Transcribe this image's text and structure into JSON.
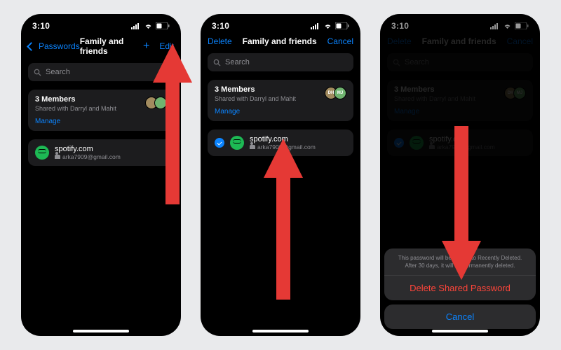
{
  "status_bar": {
    "time": "3:10"
  },
  "screen1": {
    "nav_back": "Passwords",
    "nav_title": "Family and friends",
    "nav_edit": "Edit",
    "search_placeholder": "Search",
    "members_title": "3 Members",
    "members_sub": "Shared with Darryl and Mahit",
    "manage": "Manage",
    "avatars": [
      "DH",
      "MJ"
    ],
    "cred_site": "spotify.com",
    "cred_user": "arka7909@gmail.com"
  },
  "screen2": {
    "nav_delete": "Delete",
    "nav_title": "Family and friends",
    "nav_cancel": "Cancel",
    "search_placeholder": "Search",
    "members_title": "3 Members",
    "members_sub": "Shared with Darryl and Mahit",
    "manage": "Manage",
    "avatars": [
      "DH",
      "MJ"
    ],
    "cred_site": "spotify.com",
    "cred_user": "arka7909@gmail.com"
  },
  "screen3": {
    "nav_delete": "Delete",
    "nav_title": "Family and friends",
    "nav_cancel": "Cancel",
    "search_placeholder": "Search",
    "members_title": "3 Members",
    "members_sub": "Shared with Darryl and Mahit",
    "manage": "Manage",
    "avatars": [
      "DH",
      "MJ"
    ],
    "cred_site": "spotify.com",
    "cred_user": "arka7909@gmail.com",
    "sheet_message": "This password will be moved to Recently Deleted. After 30 days, it will be permanently deleted.",
    "sheet_delete": "Delete Shared Password",
    "sheet_cancel": "Cancel"
  },
  "icons": {
    "search": "search-icon",
    "chevron_back": "chevron-back-icon",
    "plus": "plus-icon",
    "spotify": "spotify-icon",
    "people": "people-icon",
    "checkmark": "checkmark-circle-icon",
    "signal": "signal-icon",
    "wifi": "wifi-icon",
    "battery": "battery-icon"
  },
  "arrows": [
    {
      "target": "screen1-edit-button",
      "direction": "up"
    },
    {
      "target": "screen2-credential-row",
      "direction": "up"
    },
    {
      "target": "screen3-delete-button",
      "direction": "down"
    }
  ]
}
